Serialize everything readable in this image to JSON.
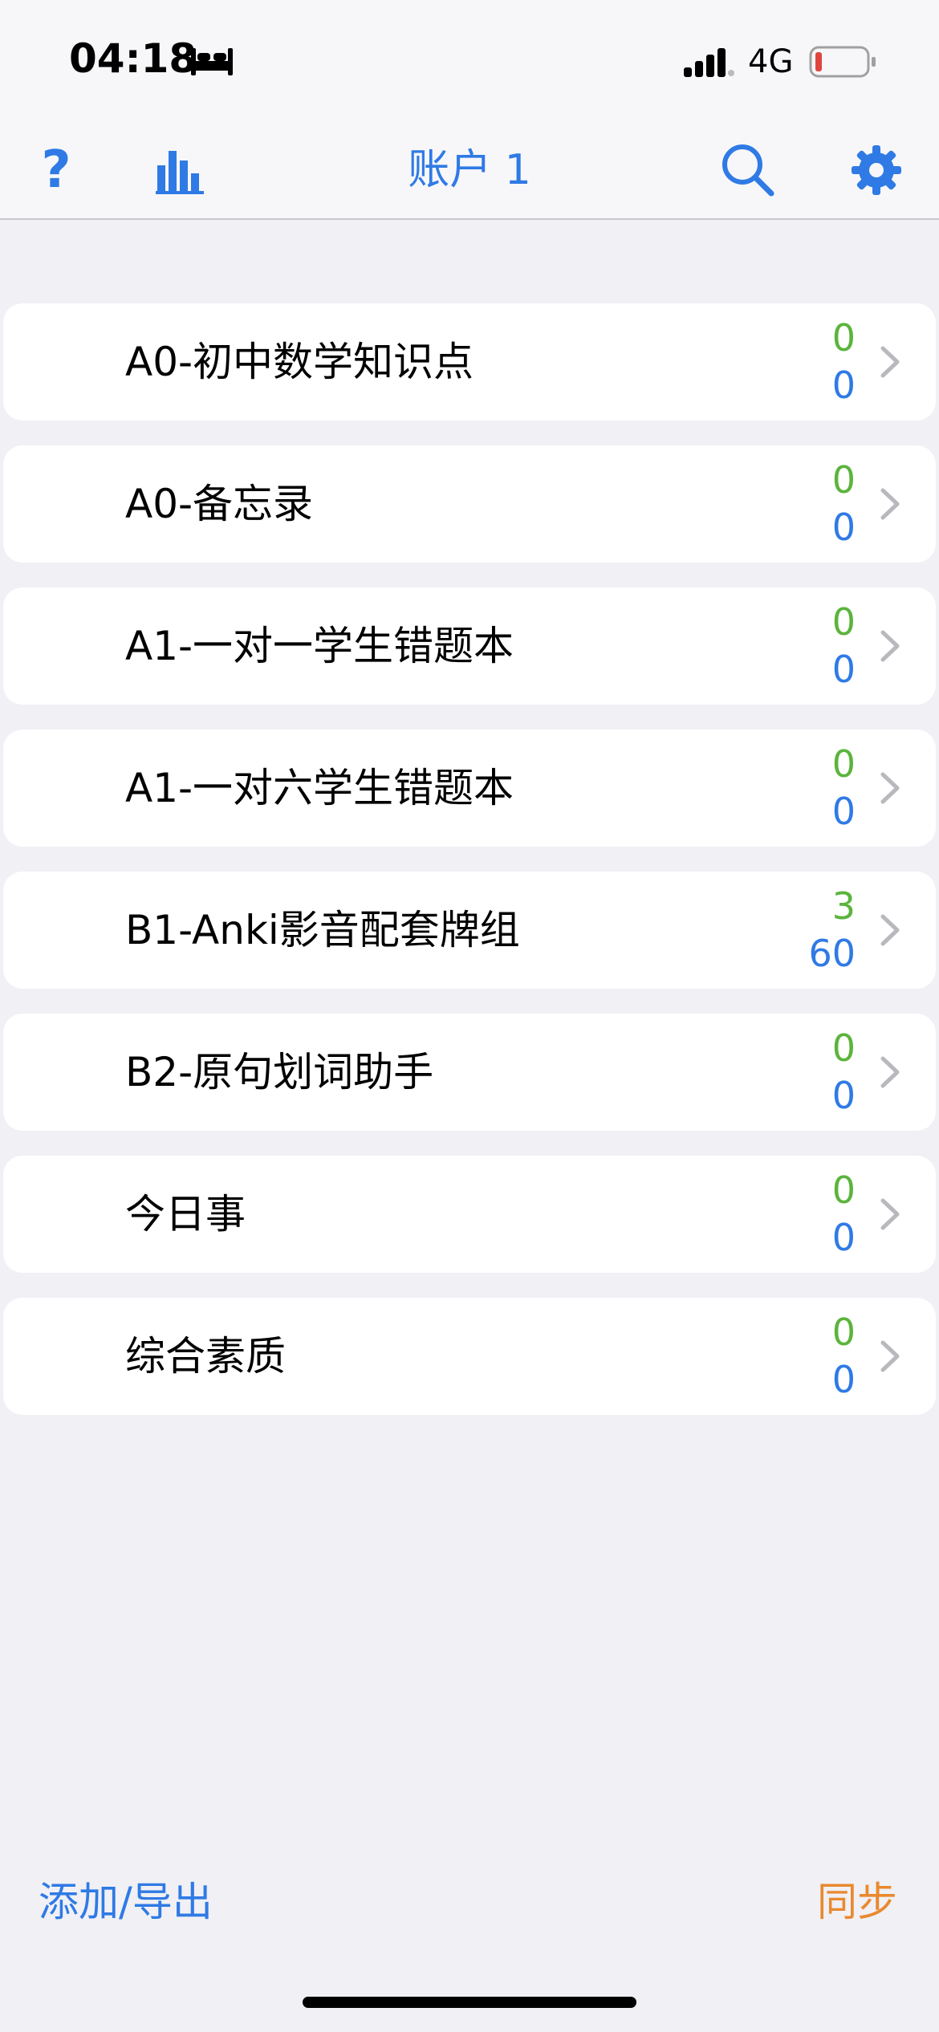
{
  "status_bar": {
    "time": "04:18",
    "network": "4G",
    "battery_color": "#e0443e",
    "icons": [
      "bed-icon",
      "signal-icon",
      "battery-icon"
    ]
  },
  "nav": {
    "title": "账户 1",
    "help_glyph": "?",
    "icons": [
      "help-icon",
      "stats-bar-chart-icon",
      "search-icon",
      "gear-icon"
    ],
    "accent_color": "#2f7ae5"
  },
  "decks": [
    {
      "name": "A0-初中数学知识点",
      "due": "0",
      "new": "0"
    },
    {
      "name": "A0-备忘录",
      "due": "0",
      "new": "0"
    },
    {
      "name": "A1-一对一学生错题本",
      "due": "0",
      "new": "0"
    },
    {
      "name": "A1-一对六学生错题本",
      "due": "0",
      "new": "0"
    },
    {
      "name": "B1-Anki影音配套牌组",
      "due": "3",
      "new": "60"
    },
    {
      "name": "B2-原句划词助手",
      "due": "0",
      "new": "0"
    },
    {
      "name": "今日事",
      "due": "0",
      "new": "0"
    },
    {
      "name": "综合素质",
      "due": "0",
      "new": "0"
    }
  ],
  "count_colors": {
    "due": "#5bb43c",
    "new": "#2f7ae5"
  },
  "footer": {
    "add_export_label": "添加/导出",
    "sync_label": "同步",
    "sync_color": "#e9892f"
  }
}
